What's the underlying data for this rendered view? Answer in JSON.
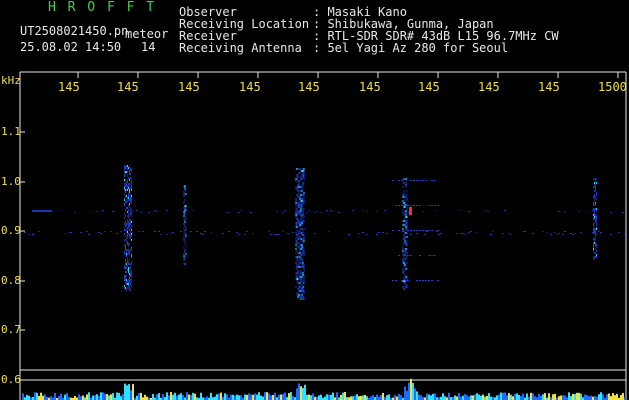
{
  "header": {
    "app_title": "H R O F F T",
    "file_name": "UT2508021450.pn",
    "mode_label": "meteor",
    "date_time": "25.08.02 14:50",
    "count": "14",
    "info": [
      {
        "label": "Observer",
        "value": ": Masaki Kano"
      },
      {
        "label": "Receiving Location",
        "value": ": Shibukawa, Gunma, Japan"
      },
      {
        "label": "Receiver",
        "value": ": RTL-SDR SDR# 43dB L15 96.7MHz CW"
      },
      {
        "label": "Receiving Antenna",
        "value": ": 5el Yagi Az 280 for Seoul"
      }
    ]
  },
  "axis": {
    "y_unit": "kHz",
    "y_ticks": [
      "1.1",
      "1.0",
      "0.9",
      "0.8",
      "0.7",
      "0.6"
    ],
    "x_ticks": [
      "145",
      "145",
      "145",
      "145",
      "145",
      "145",
      "145",
      "145",
      "145",
      "1500"
    ]
  },
  "colors": {
    "background": "#000000",
    "text_yellow": "#f0e040",
    "text_green": "#3fd14a",
    "signal_blue": "#2a4cff",
    "signal_cyan": "#30e0ff",
    "signal_red": "#ff3020"
  }
}
